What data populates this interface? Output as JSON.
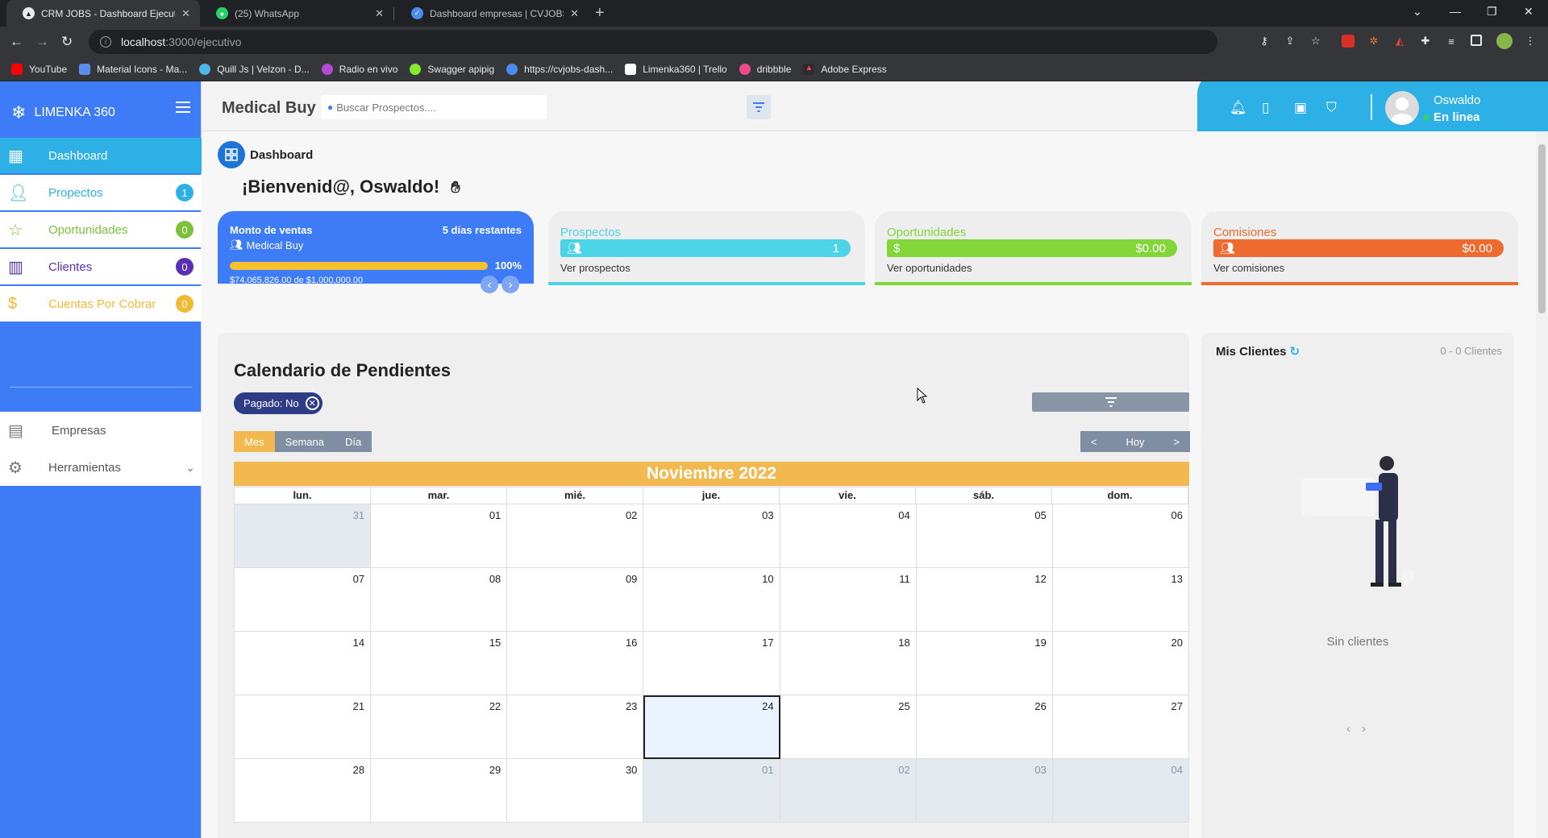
{
  "browser": {
    "tabs": [
      {
        "title": "CRM JOBS - Dashboard Ejecutivo",
        "active": true
      },
      {
        "title": "(25) WhatsApp",
        "active": false
      },
      {
        "title": "Dashboard empresas | CVJOBS",
        "active": false
      }
    ],
    "url_host": "localhost",
    "url_path": ":3000/ejecutivo",
    "bookmarks": [
      "YouTube",
      "Material Icons - Ma...",
      "Quill Js | Velzon - D...",
      "Radio en vivo",
      "Swagger apipig",
      "https://cvjobs-dash...",
      "Limenka360 | Trello",
      "dribbble",
      "Adobe Express"
    ]
  },
  "sidebar": {
    "brand": "LIMENKA 360",
    "items": [
      {
        "label": "Dashboard",
        "badge": ""
      },
      {
        "label": "Propectos",
        "badge": "1"
      },
      {
        "label": "Oportunidades",
        "badge": "0"
      },
      {
        "label": "Clientes",
        "badge": "0"
      },
      {
        "label": "Cuentas Por Cobrar",
        "badge": "0"
      },
      {
        "label": "Empresas",
        "badge": ""
      },
      {
        "label": "Herramientas",
        "badge": ""
      }
    ]
  },
  "topbar": {
    "company": "Medical Buy",
    "search_placeholder": "Buscar Prospectos....",
    "user_name": "Oswaldo",
    "user_status": "En linea"
  },
  "dashboard": {
    "breadcrumb": "Dashboard",
    "welcome": "¡Bienvenid@, Oswaldo!",
    "sales": {
      "title": "Monto de ventas",
      "remaining": "5 días restantes",
      "company": "Medical Buy",
      "progress": 1.0,
      "percent_label": "100%",
      "amount": "$74,065,826.00 de $1,000,000.00"
    },
    "kpis": [
      {
        "title": "Prospectos",
        "value": "1",
        "link": "Ver prospectos",
        "color": "#4dd3e6"
      },
      {
        "title": "Oportunidades",
        "value": "$0.00",
        "link": "Ver oportunidades",
        "color": "#83d63a"
      },
      {
        "title": "Comisiones",
        "value": "$0.00",
        "link": "Ver comisiones",
        "color": "#ef6a2f"
      }
    ]
  },
  "calendar": {
    "title": "Calendario de Pendientes",
    "filter_chip": "Pagado: No",
    "views": [
      "Mes",
      "Semana",
      "Día"
    ],
    "nav_prev": "<",
    "nav_today": "Hoy",
    "nav_next": ">",
    "month": "Noviembre 2022",
    "weekdays": [
      "lun.",
      "mar.",
      "mié.",
      "jue.",
      "vie.",
      "sáb.",
      "dom."
    ],
    "days": [
      "31",
      "01",
      "02",
      "03",
      "04",
      "05",
      "06",
      "07",
      "08",
      "09",
      "10",
      "11",
      "12",
      "13",
      "14",
      "15",
      "16",
      "17",
      "18",
      "19",
      "20",
      "21",
      "22",
      "23",
      "24",
      "25",
      "26",
      "27",
      "28",
      "29",
      "30",
      "01",
      "02",
      "03",
      "04"
    ],
    "outside_days_index": [
      0,
      31,
      32,
      33,
      34
    ],
    "today_index": 24
  },
  "clients": {
    "title": "Mis Clientes",
    "count": "0 - 0 Clientes",
    "empty": "Sin clientes",
    "prev": "‹",
    "next": "›"
  }
}
